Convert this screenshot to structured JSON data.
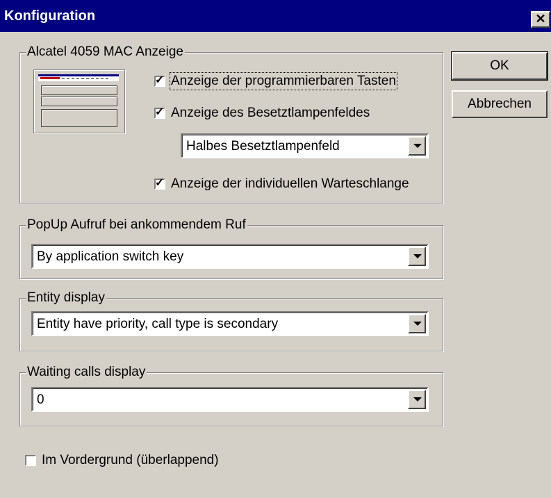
{
  "window": {
    "title": "Konfiguration",
    "close_label": "✕"
  },
  "buttons": {
    "ok": "OK",
    "cancel": "Abbrechen"
  },
  "mac_group": {
    "legend": "Alcatel 4059 MAC Anzeige",
    "cb_keys": {
      "label": "Anzeige der programmierbaren Tasten",
      "checked": true
    },
    "cb_busylamp": {
      "label": "Anzeige des Besetztlampenfeldes",
      "checked": true
    },
    "busylamp_select": {
      "value": "Halbes Besetztlampenfeld"
    },
    "cb_queue": {
      "label": "Anzeige der individuellen Warteschlange",
      "checked": true
    }
  },
  "popup_group": {
    "legend": "PopUp Aufruf bei ankommendem Ruf",
    "value": "By application switch key"
  },
  "entity_group": {
    "legend": "Entity display",
    "value": "Entity have priority, call type is secondary"
  },
  "waiting_group": {
    "legend": "Waiting calls display",
    "value": "0"
  },
  "foreground": {
    "label": "Im Vordergrund (überlappend)",
    "checked": false
  },
  "colors": {
    "titlebar": "#000080",
    "face": "#d4d0c8"
  }
}
